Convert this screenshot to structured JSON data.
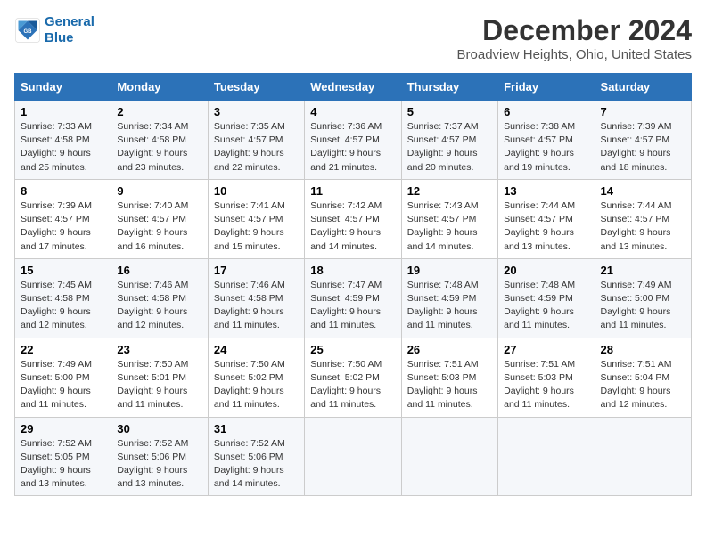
{
  "logo": {
    "line1": "General",
    "line2": "Blue"
  },
  "title": "December 2024",
  "subtitle": "Broadview Heights, Ohio, United States",
  "columns": [
    "Sunday",
    "Monday",
    "Tuesday",
    "Wednesday",
    "Thursday",
    "Friday",
    "Saturday"
  ],
  "weeks": [
    [
      {
        "day": "1",
        "sunrise": "Sunrise: 7:33 AM",
        "sunset": "Sunset: 4:58 PM",
        "daylight": "Daylight: 9 hours and 25 minutes."
      },
      {
        "day": "2",
        "sunrise": "Sunrise: 7:34 AM",
        "sunset": "Sunset: 4:58 PM",
        "daylight": "Daylight: 9 hours and 23 minutes."
      },
      {
        "day": "3",
        "sunrise": "Sunrise: 7:35 AM",
        "sunset": "Sunset: 4:57 PM",
        "daylight": "Daylight: 9 hours and 22 minutes."
      },
      {
        "day": "4",
        "sunrise": "Sunrise: 7:36 AM",
        "sunset": "Sunset: 4:57 PM",
        "daylight": "Daylight: 9 hours and 21 minutes."
      },
      {
        "day": "5",
        "sunrise": "Sunrise: 7:37 AM",
        "sunset": "Sunset: 4:57 PM",
        "daylight": "Daylight: 9 hours and 20 minutes."
      },
      {
        "day": "6",
        "sunrise": "Sunrise: 7:38 AM",
        "sunset": "Sunset: 4:57 PM",
        "daylight": "Daylight: 9 hours and 19 minutes."
      },
      {
        "day": "7",
        "sunrise": "Sunrise: 7:39 AM",
        "sunset": "Sunset: 4:57 PM",
        "daylight": "Daylight: 9 hours and 18 minutes."
      }
    ],
    [
      {
        "day": "8",
        "sunrise": "Sunrise: 7:39 AM",
        "sunset": "Sunset: 4:57 PM",
        "daylight": "Daylight: 9 hours and 17 minutes."
      },
      {
        "day": "9",
        "sunrise": "Sunrise: 7:40 AM",
        "sunset": "Sunset: 4:57 PM",
        "daylight": "Daylight: 9 hours and 16 minutes."
      },
      {
        "day": "10",
        "sunrise": "Sunrise: 7:41 AM",
        "sunset": "Sunset: 4:57 PM",
        "daylight": "Daylight: 9 hours and 15 minutes."
      },
      {
        "day": "11",
        "sunrise": "Sunrise: 7:42 AM",
        "sunset": "Sunset: 4:57 PM",
        "daylight": "Daylight: 9 hours and 14 minutes."
      },
      {
        "day": "12",
        "sunrise": "Sunrise: 7:43 AM",
        "sunset": "Sunset: 4:57 PM",
        "daylight": "Daylight: 9 hours and 14 minutes."
      },
      {
        "day": "13",
        "sunrise": "Sunrise: 7:44 AM",
        "sunset": "Sunset: 4:57 PM",
        "daylight": "Daylight: 9 hours and 13 minutes."
      },
      {
        "day": "14",
        "sunrise": "Sunrise: 7:44 AM",
        "sunset": "Sunset: 4:57 PM",
        "daylight": "Daylight: 9 hours and 13 minutes."
      }
    ],
    [
      {
        "day": "15",
        "sunrise": "Sunrise: 7:45 AM",
        "sunset": "Sunset: 4:58 PM",
        "daylight": "Daylight: 9 hours and 12 minutes."
      },
      {
        "day": "16",
        "sunrise": "Sunrise: 7:46 AM",
        "sunset": "Sunset: 4:58 PM",
        "daylight": "Daylight: 9 hours and 12 minutes."
      },
      {
        "day": "17",
        "sunrise": "Sunrise: 7:46 AM",
        "sunset": "Sunset: 4:58 PM",
        "daylight": "Daylight: 9 hours and 11 minutes."
      },
      {
        "day": "18",
        "sunrise": "Sunrise: 7:47 AM",
        "sunset": "Sunset: 4:59 PM",
        "daylight": "Daylight: 9 hours and 11 minutes."
      },
      {
        "day": "19",
        "sunrise": "Sunrise: 7:48 AM",
        "sunset": "Sunset: 4:59 PM",
        "daylight": "Daylight: 9 hours and 11 minutes."
      },
      {
        "day": "20",
        "sunrise": "Sunrise: 7:48 AM",
        "sunset": "Sunset: 4:59 PM",
        "daylight": "Daylight: 9 hours and 11 minutes."
      },
      {
        "day": "21",
        "sunrise": "Sunrise: 7:49 AM",
        "sunset": "Sunset: 5:00 PM",
        "daylight": "Daylight: 9 hours and 11 minutes."
      }
    ],
    [
      {
        "day": "22",
        "sunrise": "Sunrise: 7:49 AM",
        "sunset": "Sunset: 5:00 PM",
        "daylight": "Daylight: 9 hours and 11 minutes."
      },
      {
        "day": "23",
        "sunrise": "Sunrise: 7:50 AM",
        "sunset": "Sunset: 5:01 PM",
        "daylight": "Daylight: 9 hours and 11 minutes."
      },
      {
        "day": "24",
        "sunrise": "Sunrise: 7:50 AM",
        "sunset": "Sunset: 5:02 PM",
        "daylight": "Daylight: 9 hours and 11 minutes."
      },
      {
        "day": "25",
        "sunrise": "Sunrise: 7:50 AM",
        "sunset": "Sunset: 5:02 PM",
        "daylight": "Daylight: 9 hours and 11 minutes."
      },
      {
        "day": "26",
        "sunrise": "Sunrise: 7:51 AM",
        "sunset": "Sunset: 5:03 PM",
        "daylight": "Daylight: 9 hours and 11 minutes."
      },
      {
        "day": "27",
        "sunrise": "Sunrise: 7:51 AM",
        "sunset": "Sunset: 5:03 PM",
        "daylight": "Daylight: 9 hours and 11 minutes."
      },
      {
        "day": "28",
        "sunrise": "Sunrise: 7:51 AM",
        "sunset": "Sunset: 5:04 PM",
        "daylight": "Daylight: 9 hours and 12 minutes."
      }
    ],
    [
      {
        "day": "29",
        "sunrise": "Sunrise: 7:52 AM",
        "sunset": "Sunset: 5:05 PM",
        "daylight": "Daylight: 9 hours and 13 minutes."
      },
      {
        "day": "30",
        "sunrise": "Sunrise: 7:52 AM",
        "sunset": "Sunset: 5:06 PM",
        "daylight": "Daylight: 9 hours and 13 minutes."
      },
      {
        "day": "31",
        "sunrise": "Sunrise: 7:52 AM",
        "sunset": "Sunset: 5:06 PM",
        "daylight": "Daylight: 9 hours and 14 minutes."
      },
      null,
      null,
      null,
      null
    ]
  ]
}
